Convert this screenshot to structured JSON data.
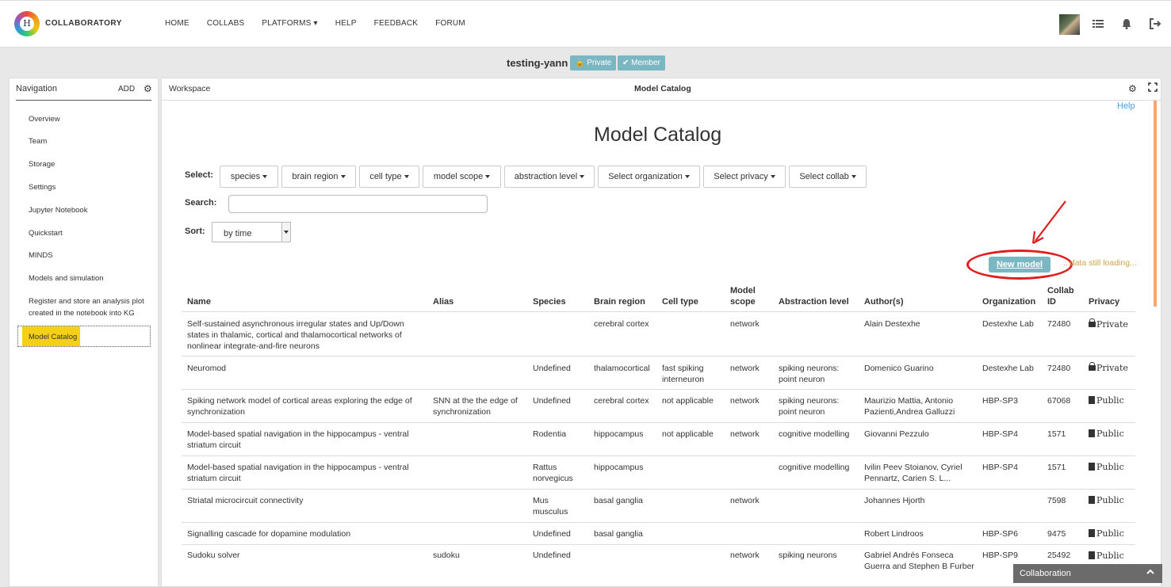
{
  "app": {
    "brand": "COLLABORATORY",
    "logo_text": "H",
    "nav": [
      "HOME",
      "COLLABS",
      "PLATFORMS ▾",
      "HELP",
      "FEEDBACK",
      "FORUM"
    ]
  },
  "collab": {
    "title": "testing-yann",
    "badges": [
      "🔒 Private",
      "✔ Member"
    ]
  },
  "navigation": {
    "title": "Navigation",
    "add_label": "ADD",
    "items": [
      "Overview",
      "Team",
      "Storage",
      "Settings",
      "Jupyter Notebook",
      "Quickstart",
      "MINDS",
      "Models and simulation",
      "Register and store an analysis plot created in the notebook into KG",
      "Model Catalog"
    ],
    "active_item": "Model Catalog"
  },
  "workspace": {
    "label": "Workspace",
    "title": "Model Catalog",
    "help": "Help",
    "heading": "Model Catalog",
    "select_label": "Select:",
    "search_label": "Search:",
    "search_value": "",
    "sort_label": "Sort:",
    "sort_value": "by time",
    "filters": [
      "species",
      "brain region",
      "cell type",
      "model scope",
      "abstraction level",
      "Select organization",
      "Select privacy",
      "Select collab"
    ],
    "new_model": "New model",
    "loading_text": "...data still loading..."
  },
  "table": {
    "headers": [
      "Name",
      "Alias",
      "Species",
      "Brain region",
      "Cell type",
      "Model scope",
      "Abstraction level",
      "Author(s)",
      "Organization",
      "Collab ID",
      "Privacy"
    ],
    "rows": [
      [
        "Self-sustained asynchronous irregular states and Up/Down states in thalamic, cortical and thalamocortical networks of nonlinear integrate-and-fire neurons",
        "",
        "",
        "cerebral cortex",
        "",
        "network",
        "",
        "Alain Destexhe",
        "Destexhe Lab",
        "72480",
        "Private"
      ],
      [
        "Neuromod",
        "",
        "Undefined",
        "thalamocortical",
        "fast spiking interneuron",
        "network",
        "spiking neurons: point neuron",
        "Domenico Guarino",
        "Destexhe Lab",
        "72480",
        "Private"
      ],
      [
        "Spiking network model of cortical areas exploring the edge of synchronization",
        "SNN at the the edge of synchronization",
        "Undefined",
        "cerebral cortex",
        "not applicable",
        "network",
        "spiking neurons: point neuron",
        "Maurizio Mattia, Antonio Pazienti,Andrea Galluzzi",
        "HBP-SP3",
        "67068",
        "Public"
      ],
      [
        "Model-based spatial navigation in the hippocampus - ventral striatum circuit",
        "",
        "Rodentia",
        "hippocampus",
        "not applicable",
        "network",
        "cognitive modelling",
        "Giovanni Pezzulo",
        "HBP-SP4",
        "1571",
        "Public"
      ],
      [
        "Model-based spatial navigation in the hippocampus - ventral striatum circuit",
        "",
        "Rattus norvegicus",
        "hippocampus",
        "",
        "",
        "cognitive modelling",
        "Ivilin Peev Stoianov, Cyriel Pennartz, Carien S. L...",
        "HBP-SP4",
        "1571",
        "Public"
      ],
      [
        "Striatal microcircuit connectivity",
        "",
        "Mus musculus",
        "basal ganglia",
        "",
        "network",
        "",
        "Johannes Hjorth",
        "",
        "7598",
        "Public"
      ],
      [
        "Signalling cascade for dopamine modulation",
        "",
        "Undefined",
        "basal ganglia",
        "",
        "",
        "",
        "Robert Lindroos",
        "HBP-SP6",
        "9475",
        "Public"
      ],
      [
        "Sudoku solver",
        "sudoku",
        "Undefined",
        "",
        "",
        "network",
        "spiking neurons",
        "Gabriel Andrés Fonseca Guerra and Stephen B Furber",
        "HBP-SP9",
        "25492",
        "Public"
      ]
    ]
  },
  "footer": {
    "collaboration": "Collaboration"
  },
  "colors": {
    "badge": "#7bb7c3",
    "active_nav": "#f5d016",
    "loading": "#c9a64a",
    "annotation": "#e01e1e",
    "help_link": "#4a9cd6"
  }
}
